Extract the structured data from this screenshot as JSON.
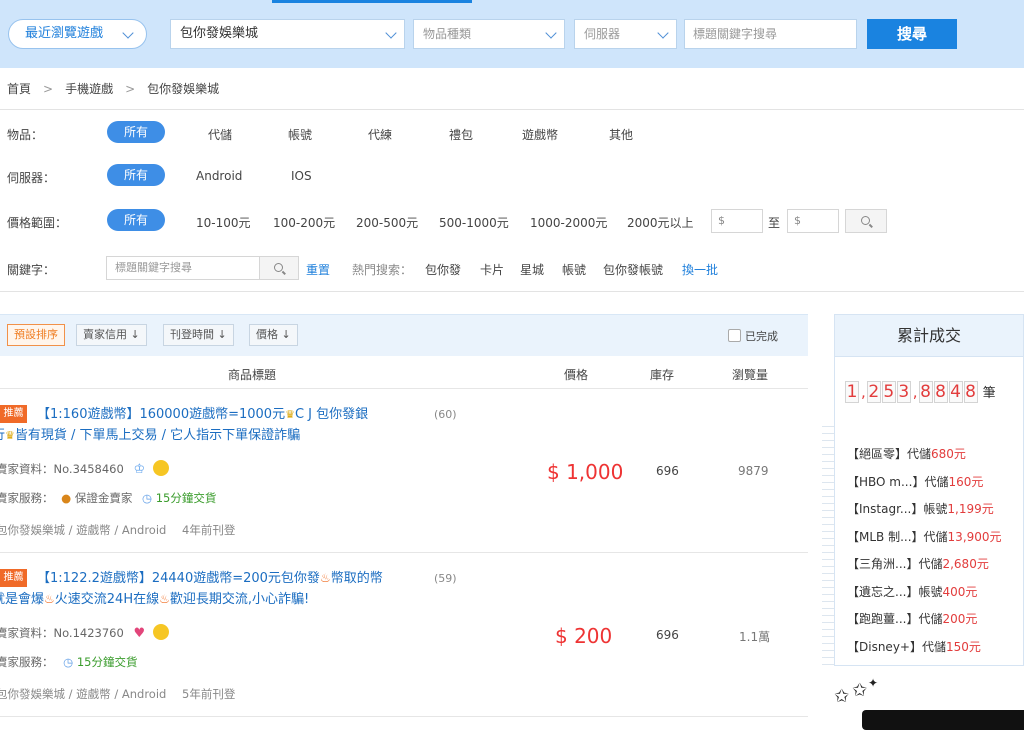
{
  "topbar": {
    "recent_games": "最近瀏覽遊戲",
    "game_select": "包你發娛樂城",
    "item_type_placeholder": "物品種類",
    "server_placeholder": "伺服器",
    "keyword_placeholder": "標題關鍵字搜尋",
    "search_label": "搜尋"
  },
  "breadcrumb": [
    "首頁",
    "手機遊戲",
    "包你發娛樂城"
  ],
  "filters": {
    "item": {
      "label": "物品：",
      "options": [
        "所有",
        "代儲",
        "帳號",
        "代練",
        "禮包",
        "遊戲幣",
        "其他"
      ]
    },
    "server": {
      "label": "伺服器：",
      "options": [
        "所有",
        "Android",
        "IOS"
      ]
    },
    "price": {
      "label": "價格範圍：",
      "options": [
        "所有",
        "10-100元",
        "100-200元",
        "200-500元",
        "500-1000元",
        "1000-2000元",
        "2000元以上"
      ],
      "min_placeholder": "$",
      "to": "至",
      "max_placeholder": "$"
    },
    "keyword": {
      "label": "關鍵字：",
      "placeholder": "標題關鍵字搜尋",
      "reset": "重置",
      "hot_label": "熱門搜索：",
      "hot": [
        "包你發",
        "卡片",
        "星城",
        "帳號",
        "包你發帳號"
      ],
      "refresh": "換一批"
    }
  },
  "sort": {
    "buttons": [
      "預設排序",
      "賣家信用 ↓",
      "刊登時間 ↓",
      "價格 ↓"
    ],
    "completed": "已完成"
  },
  "table": {
    "headers": [
      "商品標題",
      "價格",
      "庫存",
      "瀏覽量"
    ]
  },
  "items": [
    {
      "tag": "推薦",
      "title_line1": "【1:160遊戲幣】160000遊戲幣=1000元",
      "title_line1_tail": "C J 包你發銀",
      "title_line2_head": "行",
      "title_line2": "皆有現貨 / 下單馬上交易 / 它人指示下單保證詐騙",
      "count": "(60)",
      "seller": "賣家資料：No.3458460",
      "service_label": "賣家服務：",
      "service_badge": "保證金賣家",
      "service_time": "15分鐘交貨",
      "category": "包你發娛樂城 / 遊戲幣 / Android",
      "posted": "4年前刊登",
      "price": "$ 1,000",
      "stock": "696",
      "views": "9879"
    },
    {
      "tag": "推薦",
      "title_line1": "【1:122.2遊戲幣】24440遊戲幣=200元包你發",
      "title_line1_tail": "幣取的幣",
      "title_line2_head": "就是會爆",
      "title_line2": "火速交流24H在線",
      "title_line2_tail": "歡迎長期交流,小心詐騙!",
      "count": "(59)",
      "seller": "賣家資料：No.1423760",
      "service_label": "賣家服務：",
      "service_time": "15分鐘交貨",
      "category": "包你發娛樂城 / 遊戲幣 / Android",
      "posted": "5年前刊登",
      "price": "$ 200",
      "stock": "696",
      "views": "1.1萬"
    }
  ],
  "sidebar": {
    "title": "累計成交",
    "digits": [
      "1",
      "2",
      "5",
      "3",
      "8",
      "8",
      "4",
      "8"
    ],
    "unit": "筆",
    "deals": [
      {
        "name": "【絕區零",
        "type": "】代儲",
        "amount": "680元"
      },
      {
        "name": "【HBO m...",
        "type": "】代儲",
        "amount": "160元"
      },
      {
        "name": "【Instagr...",
        "type": "】帳號",
        "amount": "1,199元"
      },
      {
        "name": "【MLB 制...",
        "type": "】代儲",
        "amount": "13,900元"
      },
      {
        "name": "【三角洲...",
        "type": "】代儲",
        "amount": "2,680元"
      },
      {
        "name": "【遺忘之...",
        "type": "】帳號",
        "amount": "400元"
      },
      {
        "name": "【跑跑薑...",
        "type": "】代儲",
        "amount": "200元"
      },
      {
        "name": "【Disney+",
        "type": "】代儲",
        "amount": "150元"
      }
    ]
  },
  "colors": {
    "accent": "#1a83e0",
    "price_red": "#e33333",
    "tag_orange": "#f06a28"
  }
}
